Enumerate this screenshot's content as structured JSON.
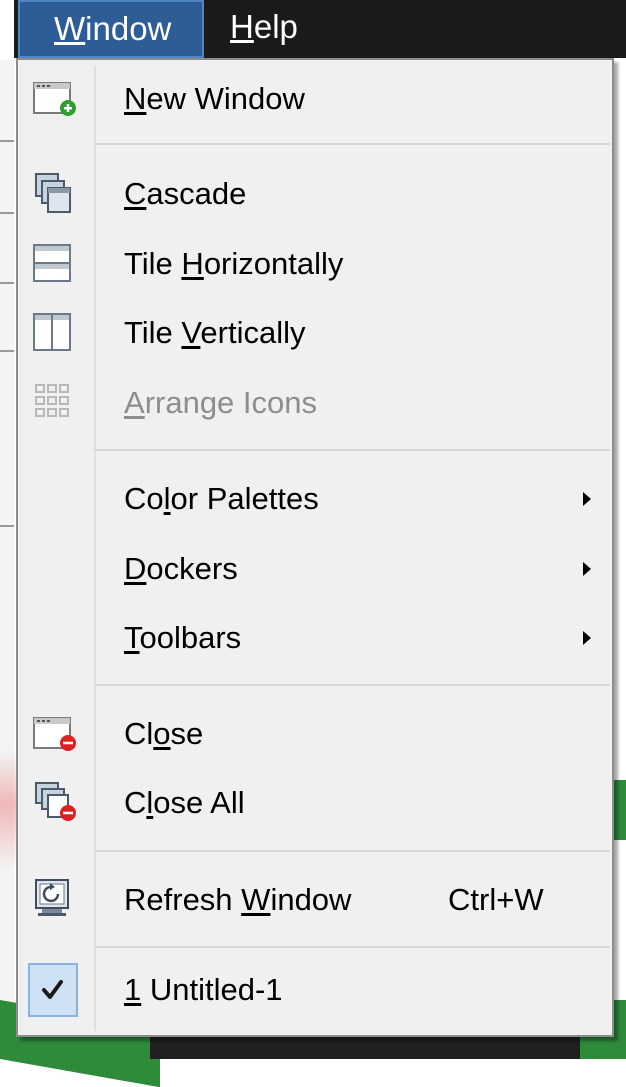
{
  "menubar": {
    "items": [
      {
        "label": "Window",
        "mnemonic": "W",
        "rest": "indow"
      },
      {
        "label": "Help",
        "mnemonic": "H",
        "rest": "elp"
      }
    ]
  },
  "menu": {
    "items": [
      {
        "label": "New Window",
        "pre": "",
        "mnemonic": "N",
        "post": "ew Window",
        "icon": "new-window-icon"
      },
      {
        "label": "Cascade",
        "pre": "",
        "mnemonic": "C",
        "post": "ascade",
        "icon": "cascade-icon"
      },
      {
        "label": "Tile Horizontally",
        "pre": "Tile ",
        "mnemonic": "H",
        "post": "orizontally",
        "icon": "tile-horizontal-icon"
      },
      {
        "label": "Tile Vertically",
        "pre": "Tile ",
        "mnemonic": "V",
        "post": "ertically",
        "icon": "tile-vertical-icon"
      },
      {
        "label": "Arrange Icons",
        "pre": "",
        "mnemonic": "A",
        "post": "rrange Icons",
        "icon": "arrange-icons-icon",
        "disabled": true
      },
      {
        "label": "Color Palettes",
        "pre": "Co",
        "mnemonic": "l",
        "post": "or Palettes",
        "submenu": true
      },
      {
        "label": "Dockers",
        "pre": "",
        "mnemonic": "D",
        "post": "ockers",
        "submenu": true
      },
      {
        "label": "Toolbars",
        "pre": "",
        "mnemonic": "T",
        "post": "oolbars",
        "submenu": true
      },
      {
        "label": "Close",
        "pre": "Cl",
        "mnemonic": "o",
        "post": "se",
        "icon": "close-window-icon"
      },
      {
        "label": "Close All",
        "pre": "C",
        "mnemonic": "l",
        "post": "ose All",
        "icon": "close-all-icon"
      },
      {
        "label": "Refresh Window",
        "pre": "Refresh ",
        "mnemonic": "W",
        "post": "indow",
        "shortcut": "Ctrl+W",
        "icon": "refresh-window-icon"
      },
      {
        "label": "1 Untitled-1",
        "pre": "",
        "mnemonic": "1",
        "post": " Untitled-1",
        "checked": true,
        "icon": "checkmark-icon"
      }
    ]
  },
  "colors": {
    "menubar_bg": "#1a1a1a",
    "active_menu": "#2d5c97",
    "dropdown_bg": "#f0f0f0",
    "disabled_text": "#8d8d8d",
    "add_badge": "#2f9e2f",
    "remove_badge": "#e02020"
  }
}
